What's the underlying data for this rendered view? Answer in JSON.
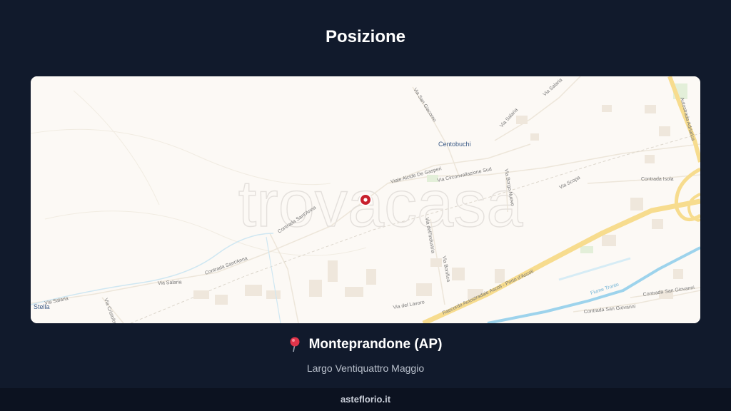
{
  "header": {
    "title": "Posizione"
  },
  "map": {
    "watermark": "trovacasa",
    "place_labels": {
      "centobuchi": "Centobuchi",
      "stella": "Stella"
    },
    "street_labels": {
      "via_san_giacomo": "Via San Giacomo",
      "via_salaria_top": "Via Salaria",
      "via_salaria_mid": "Via Salaria",
      "via_salaria_left": "Via Salaria",
      "via_salaria_bottom": "Via Salaria",
      "viale_de_gasperi": "Viale Alcide De Gasperi",
      "via_circonvallazione": "Via Circonvallazione Sud",
      "via_borgo_nuovo": "Via Borgo Nuovo",
      "via_scopa": "Via Scopa",
      "contrada_isola": "Contrada Isola",
      "contrada_santanna_1": "Contrada Sant'Anna",
      "contrada_santanna_2": "Contrada Sant'Anna",
      "via_industria": "Via dell'Industria",
      "via_bonifica": "Via Bonifica",
      "raccordo": "Raccordo Autostradale Ascoli - Porto d'Ascoli",
      "via_del_lavoro": "Via del Lavoro",
      "autostrada": "Autostrada Adriatica",
      "contrada_san_giovanni_1": "Contrada San Giovanni",
      "contrada_san_giovanni_2": "Contrada San Giovanni",
      "fiume_tronto": "Fiume Tronto",
      "via_colombo": "Via Cristoforo Colombo"
    },
    "marker_icon": "location-marker-icon"
  },
  "location": {
    "icon": "pushpin-icon",
    "city": "Monteprandone (AP)",
    "address": "Largo Ventiquattro Maggio"
  },
  "footer": {
    "text": "asteflorio.it"
  },
  "colors": {
    "background": "#111a2c",
    "map_background": "#fcf9f5",
    "highway": "#f7dc8e",
    "river": "#9dd3ec",
    "marker": "#c8202d"
  }
}
